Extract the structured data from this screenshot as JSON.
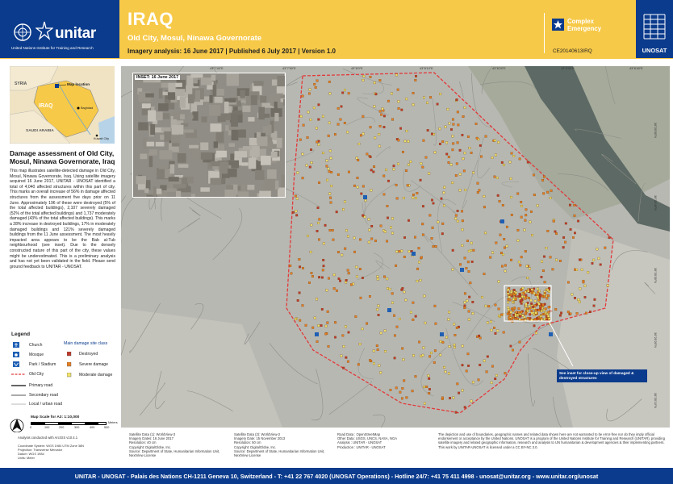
{
  "header": {
    "unitar_word": "unitar",
    "unitar_sub": "United Nations Institute for Training and Research",
    "country": "IRAQ",
    "subtitle": "Old City, Mosul, Ninawa Governorate",
    "imagery_line": "Imagery analysis: 16 June 2017 | Published 6 July 2017 | Version 1.0",
    "event_type": "Complex Emergency",
    "glide": "CE20140613IRQ",
    "unosat_word": "UNOSAT",
    "brand_color": "#0b3b8c",
    "accent_color": "#f7c948"
  },
  "location_map": {
    "labels": {
      "syria": "SYRIA",
      "iraq": "IRAQ",
      "saudi": "SAUDI ARABIA",
      "map_location": "Map location",
      "baghdad": "Baghdad",
      "kuwait": "Kuwait City"
    }
  },
  "report": {
    "title": "Damage assessment of Old City, Mosul, Ninawa Governorate, Iraq",
    "body": "This map illustrates satellite-detected damage in Old City, Mosul, Ninawa Governorate, Iraq. Using satellite imagery acquired 16 June 2017, UNITAR - UNOSAT identified a total of 4,040 affected structures within this part of city. This marks an overall increase of 56% in damage affected structures from the assessment five days prior on 11 June. Approximately 196 of these were destroyed (5% of the total affected buildings), 2,107 severely damaged (52% of the total affected buildings) and 1,737 moderately damaged (43% of the total affected buildings). This marks a 28% increase in destroyed buildings, 17% in moderately damaged buildings and 121% severely damaged buildings from the 11 June assessment. The most heavily impacted area appears to be the Bab al-Tub neighbourhood (see inset). Due to the densely constructed nature of this part of the city, these values might be underestimated. This is a preliminary analysis and has not yet been validated in the field. Please send ground feedback to UNITAR - UNOSAT."
  },
  "legend": {
    "title": "Legend",
    "items_left": [
      "Church",
      "Mosque",
      "Park / Stadium",
      "Old City",
      "Primary road",
      "Secondary road",
      "Local / urban road"
    ],
    "damage_title": "Main damage site class",
    "damage_items": [
      {
        "label": "Destroyed",
        "color": "#c0392b"
      },
      {
        "label": "Severe damage",
        "color": "#e67e22"
      },
      {
        "label": "Moderate damage",
        "color": "#f1e26a"
      }
    ]
  },
  "scale": {
    "title": "Map Scale for A3: 1:10,000",
    "ticks": [
      "0",
      "100",
      "200",
      "300",
      "400",
      "500"
    ],
    "unit": "Meters"
  },
  "metadata": {
    "software": "Analysis conducted with ArcGIS v10.4.1",
    "projection": [
      "Coordinate System: WGS 1984 UTM Zone 38N",
      "Projection: Transverse Mercator",
      "Datum: WGS 1984",
      "Units: Meter"
    ]
  },
  "map": {
    "inset_label": "INSET: 16 June 2017",
    "inset_note": "See inset for close-up view of damaged & destroyed structures",
    "lon_labels": [
      "43°7'40\"E",
      "43°7'50\"E",
      "43°8'0\"E",
      "43°8'10\"E",
      "43°8'20\"E",
      "43°8'30\"E",
      "43°8'40\"E"
    ],
    "lat_labels": [
      "36°20'50\"N",
      "36°20'40\"N",
      "36°20'30\"N",
      "36°20'20\"N",
      "36°20'10\"N"
    ]
  },
  "sources": {
    "col1": [
      "Satellite Data (1): WorldView-3",
      "Imagery Dates: 16 June 2017",
      "Resolution: 40 cm",
      "Copyright: DigitalGlobe, Inc.",
      "Source: Department of State, Humanitarian Information Unit, NextView License"
    ],
    "col2": [
      "Satellite Data (2): WorldView-2",
      "Imagery Date: 15 November 2013",
      "Resolution: 50 cm",
      "Copyright: DigitalGlobe, Inc.",
      "Source: Department of State, Humanitarian Information Unit, NextView License"
    ],
    "col3": [
      "Road Data : OpenStreetMap",
      "Other Data: USGS, UNCS, NASA, NGA",
      "Analysis : UNITAR - UNOSAT",
      "Production : UNITAR - UNOSAT"
    ],
    "disclaimer": "The depiction and use of boundaries, geographic names and related data shown here are not warranted to be error-free nor do they imply official endorsement or acceptance by the United Nations. UNOSAT is a program of the United Nations Institute for Training and Research (UNITAR), providing satellite imagery and related geographic information, research and analysis to UN humanitarian & development agencies & their implementing partners. This work by UNITAR-UNOSAT is licensed under a CC BY-NC 3.0."
  },
  "footer": {
    "text": "UNITAR - UNOSAT - Palais des Nations CH-1211 Geneva 10, Switzerland - T: +41 22 767 4020 (UNOSAT Operations) - Hotline 24/7: +41 75 411 4998 - unosat@unitar.org - www.unitar.org/unosat"
  }
}
